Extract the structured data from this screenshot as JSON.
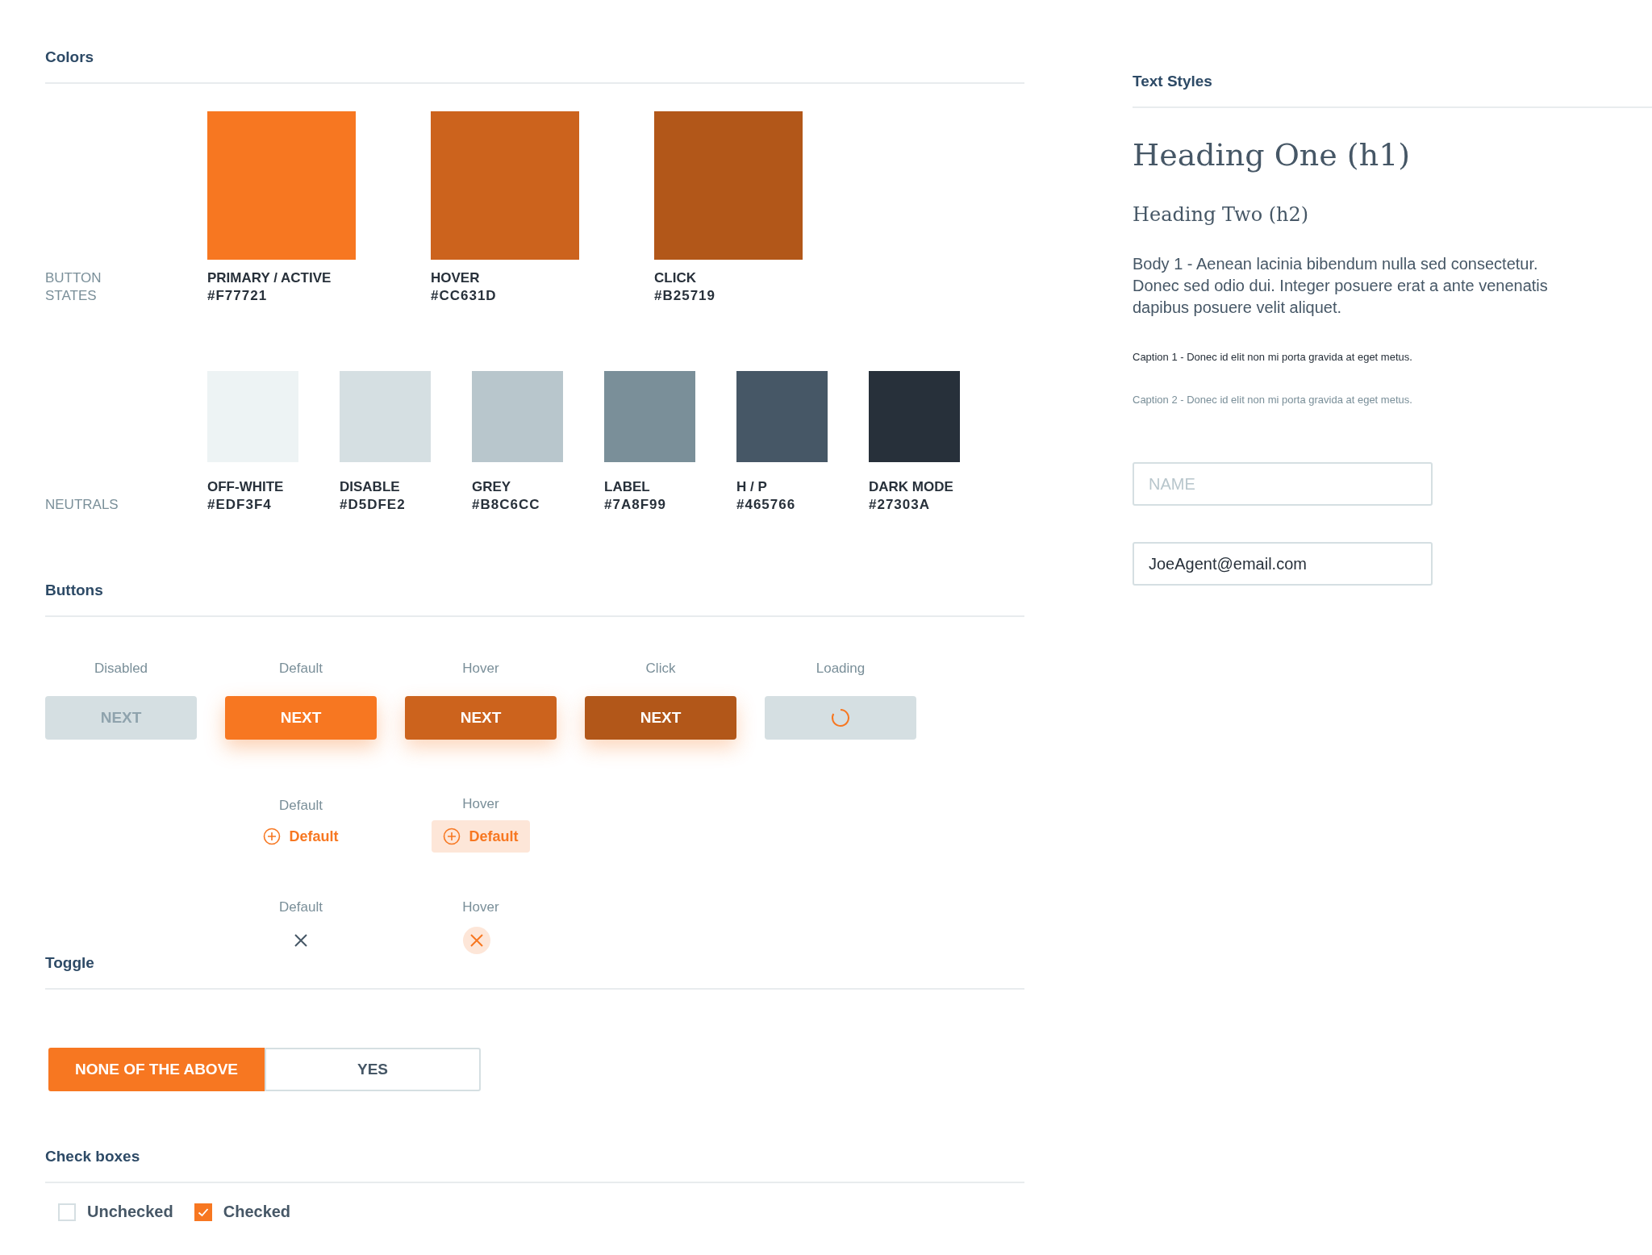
{
  "colors": {
    "title": "Colors",
    "groups": [
      {
        "label": "BUTTON STATES",
        "kind": "large",
        "swatches": [
          {
            "name": "PRIMARY / ACTIVE",
            "hex": "#F77721",
            "color": "#f77721"
          },
          {
            "name": "HOVER",
            "hex": "#CC631D",
            "color": "#cc631d"
          },
          {
            "name": "CLICK",
            "hex": "#B25719",
            "color": "#b25719"
          }
        ]
      },
      {
        "label": "NEUTRALS",
        "kind": "small",
        "swatches": [
          {
            "name": "OFF-WHITE",
            "hex": "#EDF3F4",
            "color": "#edf3f4"
          },
          {
            "name": "DISABLE",
            "hex": "#D5DFE2",
            "color": "#d5dfe2"
          },
          {
            "name": "GREY",
            "hex": "#B8C6CC",
            "color": "#b8c6cc"
          },
          {
            "name": "LABEL",
            "hex": "#7A8F99",
            "color": "#7a8f99"
          },
          {
            "name": "H / P",
            "hex": "#465766",
            "color": "#465766"
          },
          {
            "name": "DARK MODE",
            "hex": "#27303A",
            "color": "#27303a"
          }
        ]
      }
    ]
  },
  "buttons": {
    "title": "Buttons",
    "states": [
      {
        "caption": "Disabled",
        "kind": "disabled",
        "label": "NEXT"
      },
      {
        "caption": "Default",
        "kind": "default",
        "label": "NEXT"
      },
      {
        "caption": "Hover",
        "kind": "hover",
        "label": "NEXT"
      },
      {
        "caption": "Click",
        "kind": "click",
        "label": "NEXT"
      },
      {
        "caption": "Loading",
        "kind": "loading"
      }
    ],
    "link_buttons": [
      {
        "caption": "Default",
        "kind": "default",
        "label": "Default"
      },
      {
        "caption": "Hover",
        "kind": "hover",
        "label": "Default"
      }
    ],
    "close_buttons": [
      {
        "caption": "Default",
        "kind": "default"
      },
      {
        "caption": "Hover",
        "kind": "hover"
      }
    ]
  },
  "toggle": {
    "title": "Toggle",
    "options": [
      {
        "label": "NONE OF THE ABOVE",
        "selected": true
      },
      {
        "label": "YES",
        "selected": false
      }
    ]
  },
  "check_boxes": {
    "title": "Check boxes",
    "items": [
      {
        "label": "Unchecked",
        "checked": false
      },
      {
        "label": "Checked",
        "checked": true
      }
    ]
  },
  "text_styles": {
    "title": "Text Styles",
    "samples": [
      {
        "kind": "h1",
        "text": "Heading One (h1)"
      },
      {
        "kind": "h2",
        "text": "Heading Two (h2)"
      },
      {
        "kind": "body",
        "text": "Body 1 - Aenean lacinia bibendum nulla sed consectetur. Donec sed odio dui. Integer posuere erat a ante venenatis dapibus posuere velit aliquet."
      },
      {
        "kind": "caption1",
        "text": "Caption 1 - Donec id elit non mi porta gravida at eget metus."
      },
      {
        "kind": "caption2",
        "text": "Caption 2 - Donec id elit non mi porta gravida at eget metus."
      }
    ],
    "fields": [
      {
        "placeholder": "NAME"
      },
      {
        "value": "JoeAgent@email.com"
      }
    ]
  }
}
